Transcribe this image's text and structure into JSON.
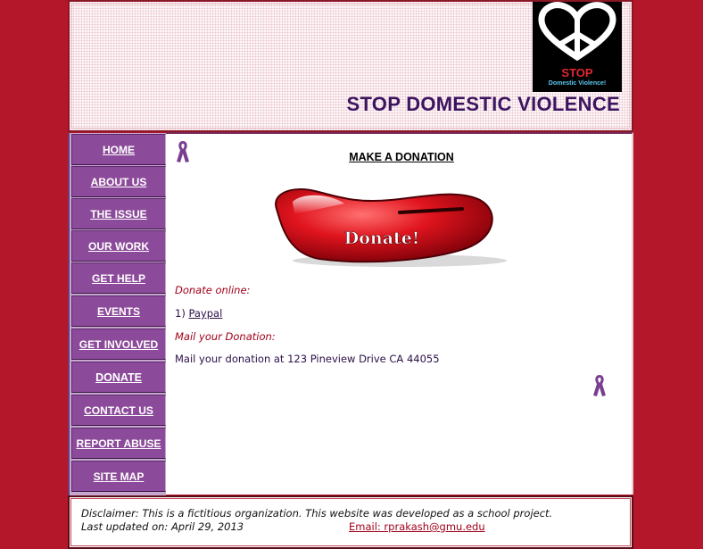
{
  "header": {
    "logo_stop": "STOP",
    "logo_sub": "Domestic Violence!",
    "site_title": "STOP DOMESTIC VIOLENCE"
  },
  "nav": {
    "items": [
      {
        "label": "HOME",
        "active": false
      },
      {
        "label": "ABOUT US",
        "active": false
      },
      {
        "label": "THE ISSUE",
        "active": false
      },
      {
        "label": "OUR WORK",
        "active": false
      },
      {
        "label": "GET HELP",
        "active": false
      },
      {
        "label": "EVENTS",
        "active": false
      },
      {
        "label": "GET INVOLVED",
        "active": false
      },
      {
        "label": "DONATE",
        "active": true
      },
      {
        "label": "CONTACT US",
        "active": false
      },
      {
        "label": "REPORT ABUSE",
        "active": false
      },
      {
        "label": "SITE MAP",
        "active": false
      }
    ]
  },
  "main": {
    "title": "MAKE A DONATION",
    "donate_image_text": "Donate!",
    "donate_online_label": "Donate online:",
    "paypal_prefix": "1) ",
    "paypal_link": "Paypal",
    "mail_label": "Mail your Donation:",
    "mail_text": "Mail your donation at 123 Pineview Drive CA 44055"
  },
  "footer": {
    "disclaimer": "Disclaimer: This is a fictitious organization. This website was developed as a school project.",
    "updated": "Last updated on: April 29, 2013",
    "email": "Email: rprakash@gmu.edu"
  },
  "colors": {
    "page_bg": "#b5172a",
    "nav_button": "#8c4b9a",
    "title_purple": "#3c1560",
    "accent_red": "#a0001a"
  }
}
